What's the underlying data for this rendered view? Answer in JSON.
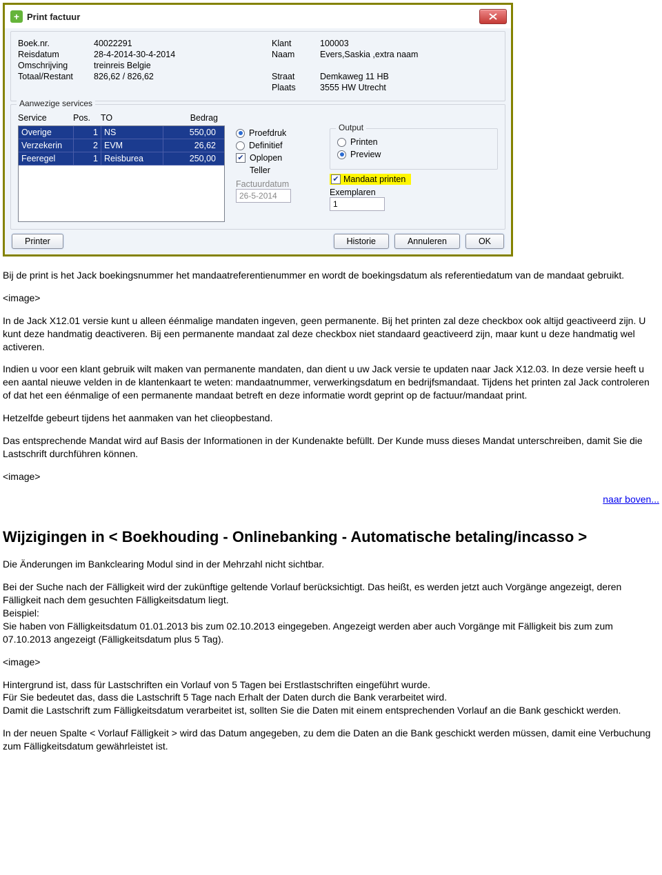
{
  "dialog": {
    "title": "Print factuur",
    "fields_left": {
      "boek_nr_label": "Boek.nr.",
      "boek_nr_value": "40022291",
      "reisdatum_label": "Reisdatum",
      "reisdatum_value": "28-4-2014-30-4-2014",
      "omschrijving_label": "Omschrijving",
      "omschrijving_value": "treinreis Belgie",
      "totaal_label": "Totaal/Restant",
      "totaal_value": "826,62 / 826,62"
    },
    "fields_right": {
      "klant_label": "Klant",
      "klant_value": "100003",
      "naam_label": "Naam",
      "naam_value": "Evers,Saskia ,extra naam",
      "straat_label": "Straat",
      "straat_value": "Demkaweg 11 HB",
      "plaats_label": "Plaats",
      "plaats_value": "3555 HW Utrecht"
    },
    "services_legend": "Aanwezige services",
    "service_headers": {
      "service": "Service",
      "pos": "Pos.",
      "to": "TO",
      "bedrag": "Bedrag"
    },
    "services": [
      {
        "service": "Overige",
        "pos": "1",
        "to": "NS",
        "bedrag": "550,00"
      },
      {
        "service": "Verzekerin",
        "pos": "2",
        "to": "EVM",
        "bedrag": "26,62"
      },
      {
        "service": "Feeregel",
        "pos": "1",
        "to": "Reisburea",
        "bedrag": "250,00"
      }
    ],
    "mid": {
      "proefdruk": "Proefdruk",
      "definitief": "Definitief",
      "oplopen": "Oplopen",
      "teller": "Teller",
      "factuurdatum_label": "Factuurdatum",
      "factuurdatum_value": "26-5-2014"
    },
    "output": {
      "legend": "Output",
      "printen": "Printen",
      "preview": "Preview",
      "mandaat": "Mandaat printen",
      "exemplaren_label": "Exemplaren",
      "exemplaren_value": "1"
    },
    "buttons": {
      "printer": "Printer",
      "historie": "Historie",
      "annuleren": "Annuleren",
      "ok": "OK"
    }
  },
  "doc": {
    "p1": "Bij de print is het Jack boekingsnummer het mandaatreferentienummer en wordt de boekingsdatum als referentiedatum van de mandaat gebruikt.",
    "img1": "<image>",
    "p2": "In de Jack X12.01 versie kunt u alleen éénmalige mandaten ingeven, geen permanente. Bij het printen zal deze checkbox ook altijd geactiveerd zijn. U kunt deze handmatig deactiveren. Bij een permanente mandaat zal deze checkbox niet standaard geactiveerd zijn, maar kunt u deze handmatig wel activeren.",
    "p3": "Indien u voor een klant gebruik wilt maken van permanente mandaten, dan dient u uw Jack versie te updaten naar Jack X12.03. In deze versie heeft u een aantal nieuwe velden in de klantenkaart te weten: mandaatnummer, verwerkingsdatum en bedrijfsmandaat. Tijdens het printen zal Jack controleren of dat het een éénmalige of een permanente mandaat betreft en deze informatie wordt geprint op de factuur/mandaat print.",
    "p4": "Hetzelfde gebeurt tijdens het aanmaken van het clieopbestand.",
    "p5": "Das entsprechende Mandat wird auf Basis der Informationen in der Kundenakte befüllt. Der Kunde muss dieses Mandat unterschreiben, damit Sie die Lastschrift durchführen können.",
    "img2": "<image>",
    "toplink": "naar boven...",
    "heading": "Wijzigingen in < Boekhouding - Onlinebanking - Automatische betaling/incasso >",
    "p6": "Die Änderungen im Bankclearing Modul sind in der Mehrzahl nicht sichtbar.",
    "p7a": "Bei der Suche nach der Fälligkeit wird der zukünftige geltende Vorlauf berücksichtigt. Das heißt, es werden jetzt auch Vorgänge angezeigt, deren Fälligkeit nach dem gesuchten Fälligkeitsdatum liegt.",
    "p7b": "Beispiel:",
    "p7c": "Sie haben von Fälligkeitsdatum 01.01.2013 bis zum 02.10.2013 eingegeben. Angezeigt werden aber auch Vorgänge mit Fälligkeit bis zum zum 07.10.2013 angezeigt (Fälligkeitsdatum plus 5 Tag).",
    "img3": "<image>",
    "p8a": "Hintergrund ist, dass für Lastschriften ein Vorlauf von 5 Tagen bei Erstlastschriften eingeführt wurde.",
    "p8b": "Für Sie bedeutet das, dass die Lastschrift 5 Tage nach Erhalt der Daten durch die Bank verarbeitet wird.",
    "p8c": "Damit die Lastschrift zum Fälligkeitsdatum verarbeitet ist, sollten Sie die Daten mit einem entsprechenden Vorlauf an die Bank geschickt werden.",
    "p9": "In der neuen Spalte < Vorlauf Fälligkeit > wird das Datum angegeben, zu dem die Daten an die Bank geschickt werden müssen, damit eine Verbuchung zum Fälligkeitsdatum gewährleistet ist."
  }
}
